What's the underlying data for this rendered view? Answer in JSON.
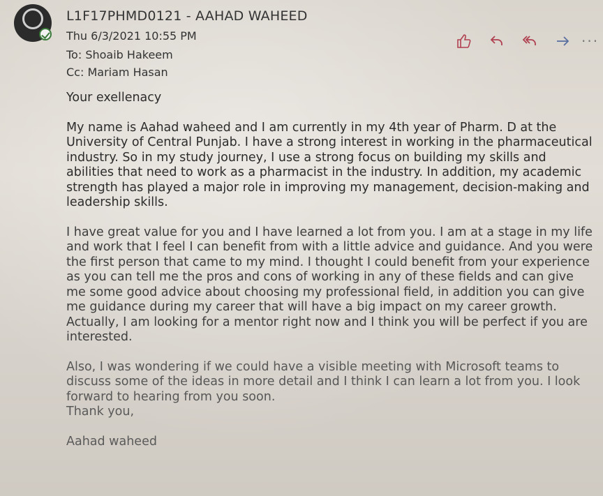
{
  "header": {
    "sender": "L1F17PHMD0121 - AAHAD WAHEED",
    "date": "Thu 6/3/2021 10:55 PM",
    "to_label": "To:",
    "to": "Shoaib Hakeem",
    "cc_label": "Cc:",
    "cc": "Mariam Hasan"
  },
  "actions": {
    "like_icon": "thumbs-up-icon",
    "reply_icon": "reply-icon",
    "reply_all_icon": "reply-all-icon",
    "forward_icon": "forward-icon",
    "more_icon": "more-icon",
    "more_label": "···",
    "accent": "#b04050"
  },
  "message": {
    "greeting": "Your exellenacy",
    "paragraph1": "My name is Aahad waheed and I am currently in my 4th year of Pharm. D at the University of Central Punjab. I have a strong interest in working in the pharmaceutical industry. So in my study journey, I use a strong focus on building my skills and abilities that need to work as a pharmacist in the industry. In addition, my academic strength has played a major role in improving my management, decision-making and leadership skills.",
    "paragraph2": "I have great value for you and I have learned a lot from you. I am at a stage in my life and work that I feel I can benefit from with a little advice and guidance. And you were the first person that came to my mind. I thought I could benefit from your experience as you can tell me the pros and cons of working in any of these fields and can give me some good advice about choosing my professional field, in addition you can give me guidance during my career that will have a big impact on my career growth. Actually, I am looking for a mentor right now and I think you will be perfect if you are interested.",
    "paragraph3": "Also, I was wondering if we could have a visible meeting with Microsoft teams to discuss some of the ideas in more detail and I think I can learn a lot from you. I look forward to hearing from you soon.",
    "closing": "Thank you,",
    "signature": "Aahad waheed"
  }
}
